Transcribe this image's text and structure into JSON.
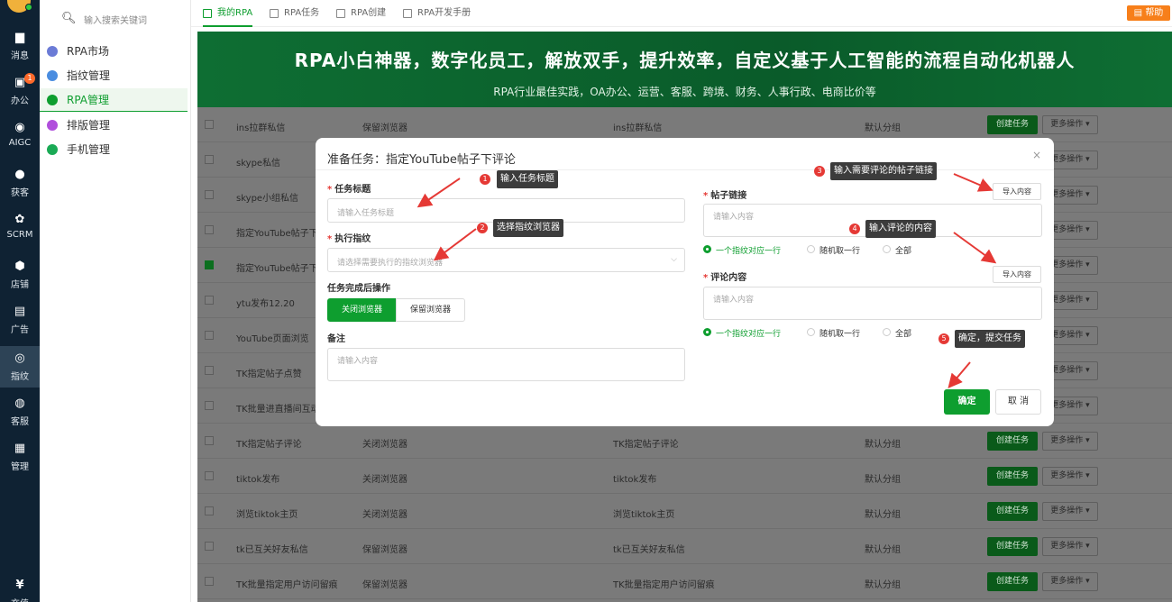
{
  "rail": {
    "items": [
      {
        "label": "消息",
        "icon": "chat-icon"
      },
      {
        "label": "办公",
        "icon": "office-icon",
        "badge": "1"
      },
      {
        "label": "AIGC",
        "icon": "aigc-icon"
      },
      {
        "label": "获客",
        "icon": "user-icon"
      },
      {
        "label": "SCRM",
        "icon": "scrm-icon"
      },
      {
        "label": "店铺",
        "icon": "store-icon"
      },
      {
        "label": "广告",
        "icon": "ads-icon"
      },
      {
        "label": "指纹",
        "icon": "fingerprint-icon"
      },
      {
        "label": "客服",
        "icon": "service-icon"
      },
      {
        "label": "管理",
        "icon": "grid-icon"
      },
      {
        "label": "充值",
        "icon": "recharge-icon"
      }
    ]
  },
  "sidebar": {
    "search_placeholder": "输入搜索关键词",
    "items": [
      {
        "label": "RPA市场",
        "color": "#6b7bd6"
      },
      {
        "label": "指纹管理",
        "color": "#4a8de0"
      },
      {
        "label": "RPA管理",
        "color": "#0e9e2f"
      },
      {
        "label": "排版管理",
        "color": "#b04fdc"
      },
      {
        "label": "手机管理",
        "color": "#1aaa55"
      }
    ]
  },
  "tabs": [
    {
      "label": "我的RPA"
    },
    {
      "label": "RPA任务"
    },
    {
      "label": "RPA创建"
    },
    {
      "label": "RPA开发手册"
    }
  ],
  "help_label": "帮助",
  "banner": {
    "title": "RPA小白神器，数字化员工，解放双手，提升效率，自定义基于人工智能的流程自动化机器人",
    "subtitle": "RPA行业最佳实践，OA办公、运营、客服、跨境、财务、人事行政、电商比价等"
  },
  "table": {
    "create_label": "创建任务",
    "more_label": "更多操作 ▾",
    "rows": [
      {
        "name": "ins拉群私信",
        "browser": "保留浏览器",
        "desc": "ins拉群私信",
        "group": "默认分组",
        "checked": false
      },
      {
        "name": "skype私信",
        "browser": "",
        "desc": "",
        "group": "",
        "checked": false
      },
      {
        "name": "skype小组私信",
        "browser": "",
        "desc": "",
        "group": "",
        "checked": false
      },
      {
        "name": "指定YouTube帖子下评",
        "browser": "",
        "desc": "",
        "group": "",
        "checked": false
      },
      {
        "name": "指定YouTube帖子下评",
        "browser": "",
        "desc": "",
        "group": "",
        "checked": true
      },
      {
        "name": "ytu发布12.20",
        "browser": "",
        "desc": "",
        "group": "",
        "checked": false
      },
      {
        "name": "YouTube页面浏览",
        "browser": "",
        "desc": "",
        "group": "",
        "checked": false
      },
      {
        "name": "TK指定帖子点赞",
        "browser": "",
        "desc": "",
        "group": "",
        "checked": false
      },
      {
        "name": "TK批量进直播间互动",
        "browser": "",
        "desc": "",
        "group": "",
        "checked": false
      },
      {
        "name": "TK指定帖子评论",
        "browser": "关闭浏览器",
        "desc": "TK指定帖子评论",
        "group": "默认分组",
        "checked": false
      },
      {
        "name": "tiktok发布",
        "browser": "关闭浏览器",
        "desc": "tiktok发布",
        "group": "默认分组",
        "checked": false
      },
      {
        "name": "浏览tiktok主页",
        "browser": "关闭浏览器",
        "desc": "浏览tiktok主页",
        "group": "默认分组",
        "checked": false
      },
      {
        "name": "tk已互关好友私信",
        "browser": "保留浏览器",
        "desc": "tk已互关好友私信",
        "group": "默认分组",
        "checked": false
      },
      {
        "name": "TK批量指定用户访问留痕",
        "browser": "保留浏览器",
        "desc": "TK批量指定用户访问留痕",
        "group": "默认分组",
        "checked": false
      }
    ]
  },
  "modal": {
    "title": "准备任务：指定YouTube帖子下评论",
    "close": "×",
    "task_title_label": "任务标题",
    "task_title_placeholder": "请输入任务标题",
    "fingerprint_label": "执行指纹",
    "fingerprint_placeholder": "请选择需要执行的指纹浏览器",
    "after_label": "任务完成后操作",
    "after_options": [
      "关闭浏览器",
      "保留浏览器"
    ],
    "note_label": "备注",
    "note_placeholder": "请输入内容",
    "post_link_label": "帖子链接",
    "post_link_placeholder": "请输入内容",
    "import_label": "导入内容",
    "comment_label": "评论内容",
    "comment_placeholder": "请输入内容",
    "radio_options": [
      "一个指纹对应一行",
      "随机取一行",
      "全部"
    ],
    "ok_label": "确定",
    "cancel_label": "取 消"
  },
  "annotations": [
    {
      "num": "1",
      "text": "输入任务标题"
    },
    {
      "num": "2",
      "text": "选择指纹浏览器"
    },
    {
      "num": "3",
      "text": "输入需要评论的帖子链接"
    },
    {
      "num": "4",
      "text": "输入评论的内容"
    },
    {
      "num": "5",
      "text": "确定，提交任务"
    }
  ]
}
